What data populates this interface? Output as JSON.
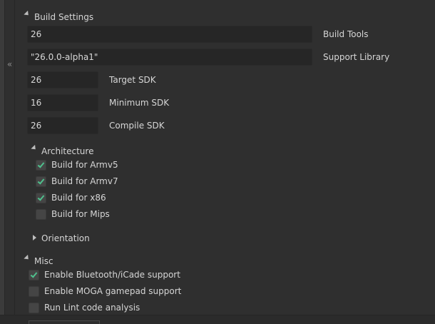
{
  "left_collapse_glyph": "«",
  "build_settings": {
    "title": "Build Settings",
    "fields": [
      {
        "key": "build_tools",
        "label": "Build Tools",
        "value": "26"
      },
      {
        "key": "support_library",
        "label": "Support Library",
        "value": "\"26.0.0-alpha1\""
      },
      {
        "key": "target_sdk",
        "label": "Target SDK",
        "value": "26"
      },
      {
        "key": "minimum_sdk",
        "label": "Minimum SDK",
        "value": "16"
      },
      {
        "key": "compile_sdk",
        "label": "Compile SDK",
        "value": "26"
      }
    ],
    "architecture": {
      "title": "Architecture",
      "options": [
        {
          "label": "Build for Armv5",
          "checked": true
        },
        {
          "label": "Build for Armv7",
          "checked": true
        },
        {
          "label": "Build for x86",
          "checked": true
        },
        {
          "label": "Build for Mips",
          "checked": false
        }
      ]
    },
    "orientation": {
      "title": "Orientation",
      "expanded": false
    }
  },
  "misc": {
    "title": "Misc",
    "options": [
      {
        "label": "Enable Bluetooth/iCade support",
        "checked": true
      },
      {
        "label": "Enable MOGA gamepad support",
        "checked": false
      },
      {
        "label": "Run Lint code analysis",
        "checked": false
      }
    ]
  },
  "colors": {
    "background": "#2f2f2f",
    "field_background": "#262626",
    "checkbox_background": "#454545",
    "check_mark": "#4fc08d",
    "text": "#d6d6d6"
  }
}
